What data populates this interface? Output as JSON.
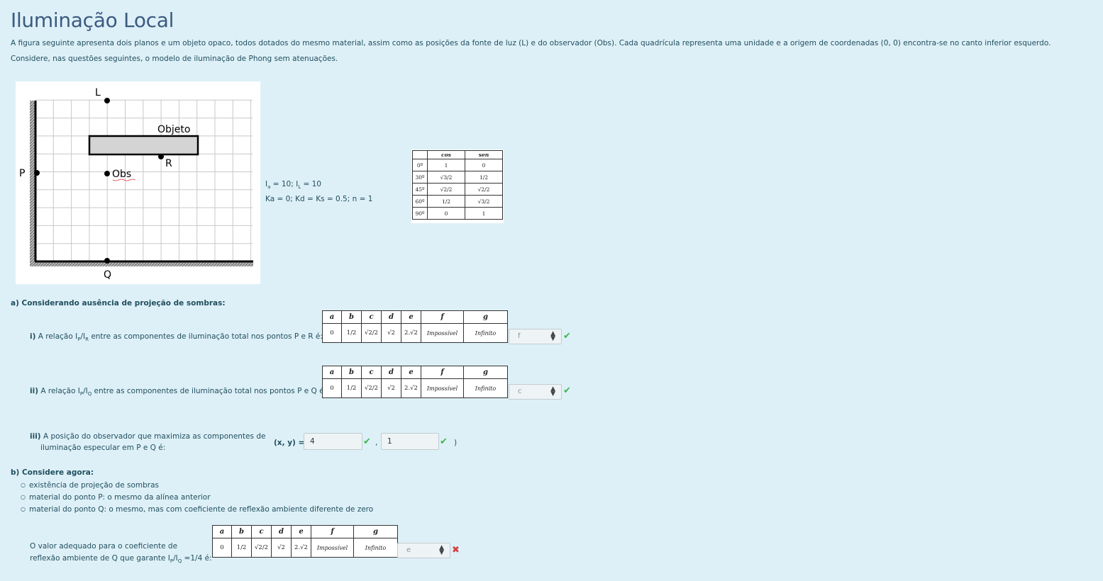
{
  "title": "Iluminação Local",
  "intro": {
    "line1": "A figura seguinte apresenta dois planos e um objeto opaco, todos dotados do mesmo material, assim como as posições da fonte de luz (L) e do observador (Obs). Cada quadrícula representa uma unidade e a origem de coordenadas (0, 0) encontra-se no canto inferior esquerdo.",
    "line2": "Considere, nas questões seguintes, o modelo de iluminação de Phong sem atenuações."
  },
  "figure": {
    "label_L": "L",
    "label_P": "P",
    "label_Q": "Q",
    "label_R": "R",
    "label_obs": "Obs",
    "label_objeto": "Objeto"
  },
  "params": {
    "line1_a": "I",
    "line1_a_sub": "a",
    "line1_b": " = 10;  I",
    "line1_b_sub": "L",
    "line1_c": " = 10",
    "line2": "Ka = 0; Kd = Ks = 0.5;    n = 1"
  },
  "trig_table": {
    "headers": [
      "",
      "cos",
      "sen"
    ],
    "rows": [
      [
        "0º",
        "1",
        "0"
      ],
      [
        "30º",
        "√3/2",
        "1/2"
      ],
      [
        "45º",
        "√2/2",
        "√2/2"
      ],
      [
        "60º",
        "1/2",
        "√3/2"
      ],
      [
        "90º",
        "0",
        "1"
      ]
    ]
  },
  "options": {
    "letters": [
      "a",
      "b",
      "c",
      "d",
      "e",
      "f",
      "g"
    ],
    "values": [
      "0",
      "1/2",
      "√2/2",
      "√2",
      "2.√2",
      "Impossível",
      "Infinito"
    ]
  },
  "section_a": {
    "heading": "a) Considerando ausência de projeção de sombras:",
    "q1": {
      "prefix": "i)",
      "text_a": " A relação I",
      "sub1": "P",
      "text_b": "/I",
      "sub2": "R",
      "text_c": " entre as componentes de iluminação total nos pontos P e R é:",
      "answer": "f",
      "status": "correct"
    },
    "q2": {
      "prefix": "ii)",
      "text_a": " A relação I",
      "sub1": "P",
      "text_b": "/I",
      "sub2": "Q",
      "text_c": " entre as componentes de iluminação total nos pontos P e Q é:",
      "answer": "c",
      "status": "correct"
    },
    "q3": {
      "prefix": "iii)",
      "text_line1": " A posição do observador que maximiza as componentes de",
      "text_line2": "iluminação especular em P e Q é:",
      "label": "(x, y) =",
      "open": "(",
      "sep": ",",
      "close": ")",
      "x_value": "4",
      "y_value": "1"
    }
  },
  "section_b": {
    "heading": "b) Considere agora:",
    "bullets": [
      "existência de projeção de sombras",
      "material do ponto P: o mesmo da alínea anterior",
      "material do ponto Q: o mesmo, mas com coeficiente de reflexão ambiente diferente de zero"
    ],
    "q_line1": "O valor adequado para o coeficiente de",
    "q_line2_a": "reflexão ambiente de Q que garante I",
    "q_sub1": "P",
    "q_line2_b": "/I",
    "q_sub2": "Q",
    "q_line2_c": " =1/4 é:",
    "answer": "e",
    "status": "incorrect"
  },
  "colors": {
    "background": "#def0f7",
    "title": "#3a5a80",
    "text": "#1f4e5e",
    "correct": "#3db84a",
    "incorrect": "#d64040"
  }
}
